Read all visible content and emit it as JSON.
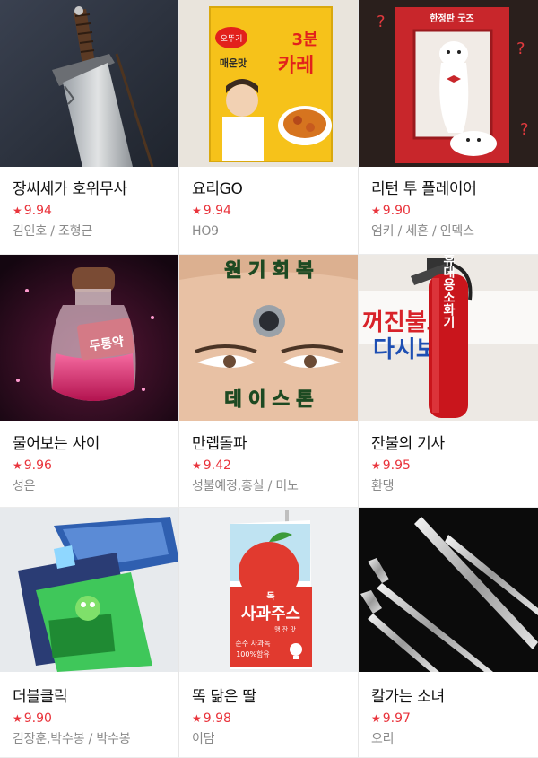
{
  "webtoons": [
    {
      "title": "장씨세가 호위무사",
      "rating": "9.94",
      "author": "김인호 / 조형근",
      "thumb": "sword-image"
    },
    {
      "title": "요리GO",
      "rating": "9.94",
      "author": "HO9",
      "thumb": "curry-box-image",
      "overlay": {
        "brand": "오뚜기",
        "badge": "3분",
        "product": "카레",
        "flavor": "매운맛"
      }
    },
    {
      "title": "리턴 투 플레이어",
      "rating": "9.90",
      "author": "엄키 / 세혼 / 인덱스",
      "thumb": "ferret-box-image",
      "overlay": {
        "label": "한정판 굿즈"
      }
    },
    {
      "title": "물어보는 사이",
      "rating": "9.96",
      "author": "성은",
      "thumb": "potion-bottle-image",
      "overlay": {
        "tag": "두통약"
      }
    },
    {
      "title": "만렙돌파",
      "rating": "9.42",
      "author": "성불예정,홍실 / 미노",
      "thumb": "forehead-image",
      "overlay": {
        "top": "원 기 회 복",
        "bottom": "데 이 스 톤"
      }
    },
    {
      "title": "잔불의 기사",
      "rating": "9.95",
      "author": "환댕",
      "thumb": "fire-extinguisher-image",
      "overlay": {
        "extinguisher": "휴대용소화기",
        "sign_line1": "꺼진불도",
        "sign_line2": "다시보자"
      }
    },
    {
      "title": "더블클릭",
      "rating": "9.90",
      "author": "김장훈,박수봉 / 박수봉",
      "thumb": "trading-cards-image"
    },
    {
      "title": "똑 닮은 딸",
      "rating": "9.98",
      "author": "이담",
      "thumb": "apple-juice-image",
      "overlay": {
        "small": "독",
        "product": "사과주스",
        "sub": "맹 잔 맛",
        "note_line1": "순수 사과독",
        "note_line2": "100%함유"
      }
    },
    {
      "title": "칼가는 소녀",
      "rating": "9.97",
      "author": "오리",
      "thumb": "cutlery-image"
    }
  ],
  "rating_star": "★",
  "colors": {
    "rating": "#e9343c",
    "title": "#111111",
    "author": "#8a8a8a"
  }
}
